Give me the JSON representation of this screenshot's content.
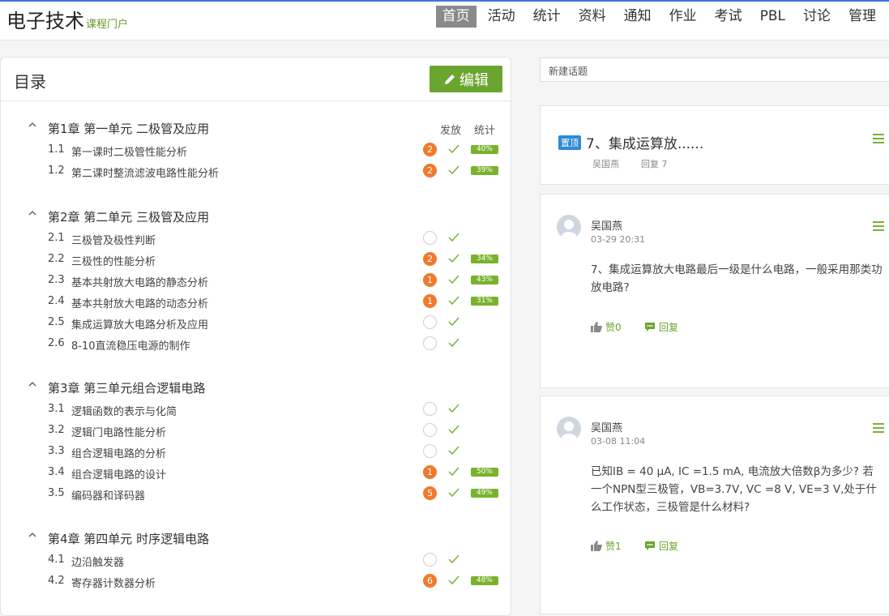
{
  "header": {
    "title": "电子技术",
    "subtitle": "课程门户",
    "nav": [
      "首页",
      "活动",
      "统计",
      "资料",
      "通知",
      "作业",
      "考试",
      "PBL",
      "讨论",
      "管理"
    ],
    "active_index": 0
  },
  "toc": {
    "title": "目录",
    "edit_label": "编辑",
    "col_publish": "发放",
    "col_stats": "统计",
    "chapters": [
      {
        "title": "第1章 第一单元 二极管及应用",
        "sections": [
          {
            "num": "1.1",
            "title": "第一课时二极管性能分析",
            "badge": "2",
            "pct": "40%"
          },
          {
            "num": "1.2",
            "title": "第二课时整流滤波电路性能分析",
            "badge": "2",
            "pct": "39%"
          }
        ]
      },
      {
        "title": "第2章 第二单元 三极管及应用",
        "sections": [
          {
            "num": "2.1",
            "title": "三极管及极性判断",
            "badge": "",
            "pct": ""
          },
          {
            "num": "2.2",
            "title": "三极性的性能分析",
            "badge": "2",
            "pct": "34%"
          },
          {
            "num": "2.3",
            "title": "基本共射放大电路的静态分析",
            "badge": "1",
            "pct": "43%"
          },
          {
            "num": "2.4",
            "title": "基本共射放大电路的动态分析",
            "badge": "1",
            "pct": "31%"
          },
          {
            "num": "2.5",
            "title": "集成运算放大电路分析及应用",
            "badge": "",
            "pct": ""
          },
          {
            "num": "2.6",
            "title": "8-10直流稳压电源的制作",
            "badge": "",
            "pct": ""
          }
        ]
      },
      {
        "title": "第3章 第三单元组合逻辑电路",
        "sections": [
          {
            "num": "3.1",
            "title": "逻辑函数的表示与化简",
            "badge": "",
            "pct": ""
          },
          {
            "num": "3.2",
            "title": "逻辑门电路性能分析",
            "badge": "",
            "pct": ""
          },
          {
            "num": "3.3",
            "title": "组合逻辑电路的分析",
            "badge": "",
            "pct": ""
          },
          {
            "num": "3.4",
            "title": "组合逻辑电路的设计",
            "badge": "1",
            "pct": "50%"
          },
          {
            "num": "3.5",
            "title": "编码器和译码器",
            "badge": "5",
            "pct": "49%"
          }
        ]
      },
      {
        "title": "第4章 第四单元 时序逻辑电路",
        "sections": [
          {
            "num": "4.1",
            "title": "边沿触发器",
            "badge": "",
            "pct": ""
          },
          {
            "num": "4.2",
            "title": "寄存器计数器分析",
            "badge": "6",
            "pct": "48%"
          }
        ]
      }
    ]
  },
  "discussion": {
    "new_topic": "新建话题",
    "pinned": {
      "tag": "置顶",
      "title": "7、集成运算放......",
      "author": "吴国燕",
      "replies": "回复 7"
    },
    "posts": [
      {
        "author": "吴国燕",
        "time": "03-29 20:31",
        "body": "7、集成运算放大电路最后一级是什么电路，一般采用那类功放电路?",
        "likes": "赞0",
        "reply": "回复"
      },
      {
        "author": "吴国燕",
        "time": "03-08 11:04",
        "body": "已知IB = 40 μA, IC =1.5 mA, 电流放大倍数β为多少? 若一个NPN型三极管，VB=3.7V, VC =8 V, VE=3 V,处于什么工作状态，三极管是什么材料?",
        "likes": "赞1",
        "reply": "回复"
      }
    ]
  },
  "colors": {
    "accent": "#6aa52f",
    "badge": "#f07a2c",
    "pinned": "#2d8ad8"
  }
}
